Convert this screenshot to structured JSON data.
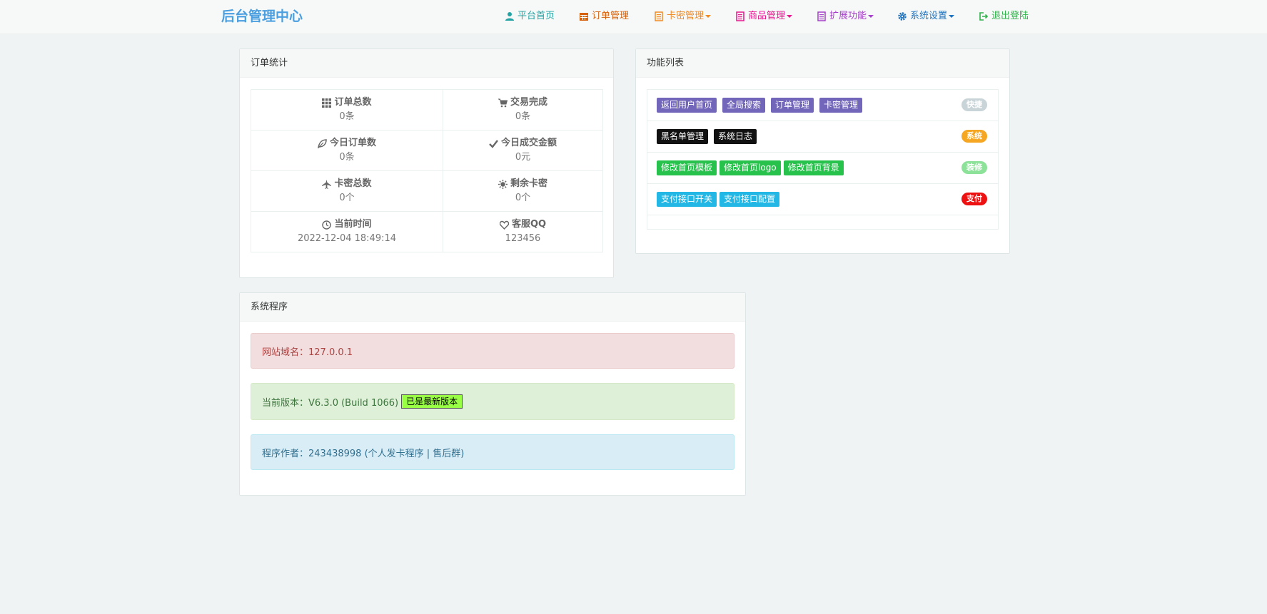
{
  "brand": "后台管理中心",
  "nav": {
    "home": "平台首页",
    "orders": "订单管理",
    "cards": "卡密管理",
    "products": "商品管理",
    "extend": "扩展功能",
    "settings": "系统设置",
    "logout": "退出登陆"
  },
  "colors": {
    "home": "#23a3a3",
    "orders": "#d4620e",
    "cards": "#f08a24",
    "products": "#e5198e",
    "extend": "#a641c9",
    "settings": "#1e73be",
    "logout": "#2fb34a"
  },
  "order_stats": {
    "title": "订单统计",
    "rows": [
      [
        {
          "label": "订单总数",
          "value": "0条",
          "icon": "grid-icon"
        },
        {
          "label": "交易完成",
          "value": "0条",
          "icon": "cart-icon"
        }
      ],
      [
        {
          "label": "今日订单数",
          "value": "0条",
          "icon": "leaf-icon"
        },
        {
          "label": "今日成交金额",
          "value": "0元",
          "icon": "check-icon"
        }
      ],
      [
        {
          "label": "卡密总数",
          "value": "0个",
          "icon": "plane-icon"
        },
        {
          "label": "剩余卡密",
          "value": "0个",
          "icon": "sun-icon"
        }
      ],
      [
        {
          "label": "当前时间",
          "value": "2022-12-04 18:49:14",
          "icon": "clock-icon"
        },
        {
          "label": "客服QQ",
          "value": "123456",
          "icon": "heart-icon"
        }
      ]
    ]
  },
  "functions": {
    "title": "功能列表",
    "rows": [
      {
        "badge": "快捷",
        "badge_color": "#c9d4d8",
        "tag_color": "#7266ba",
        "items": [
          "返回用户首页",
          "全局搜索",
          "订单管理",
          "卡密管理"
        ]
      },
      {
        "badge": "系统",
        "badge_color": "#f5a623",
        "tag_color": "#111111",
        "items": [
          "黑名单管理",
          "系统日志"
        ]
      },
      {
        "badge": "装修",
        "badge_color": "#8de29a",
        "tag_color": "#27c24c",
        "items": [
          "修改首页模板",
          "修改首页logo",
          "修改首页背景"
        ]
      },
      {
        "badge": "支付",
        "badge_color": "#ee1111",
        "tag_color": "#23b7e5",
        "items": [
          "支付接口开关",
          "支付接口配置"
        ]
      }
    ]
  },
  "system": {
    "title": "系统程序",
    "domain": "网站域名：127.0.0.1",
    "version": "当前版本：V6.3.0 (Build 1066)",
    "latest": "已是最新版本",
    "author": "程序作者：243438998 (个人发卡程序 | 售后群)"
  }
}
